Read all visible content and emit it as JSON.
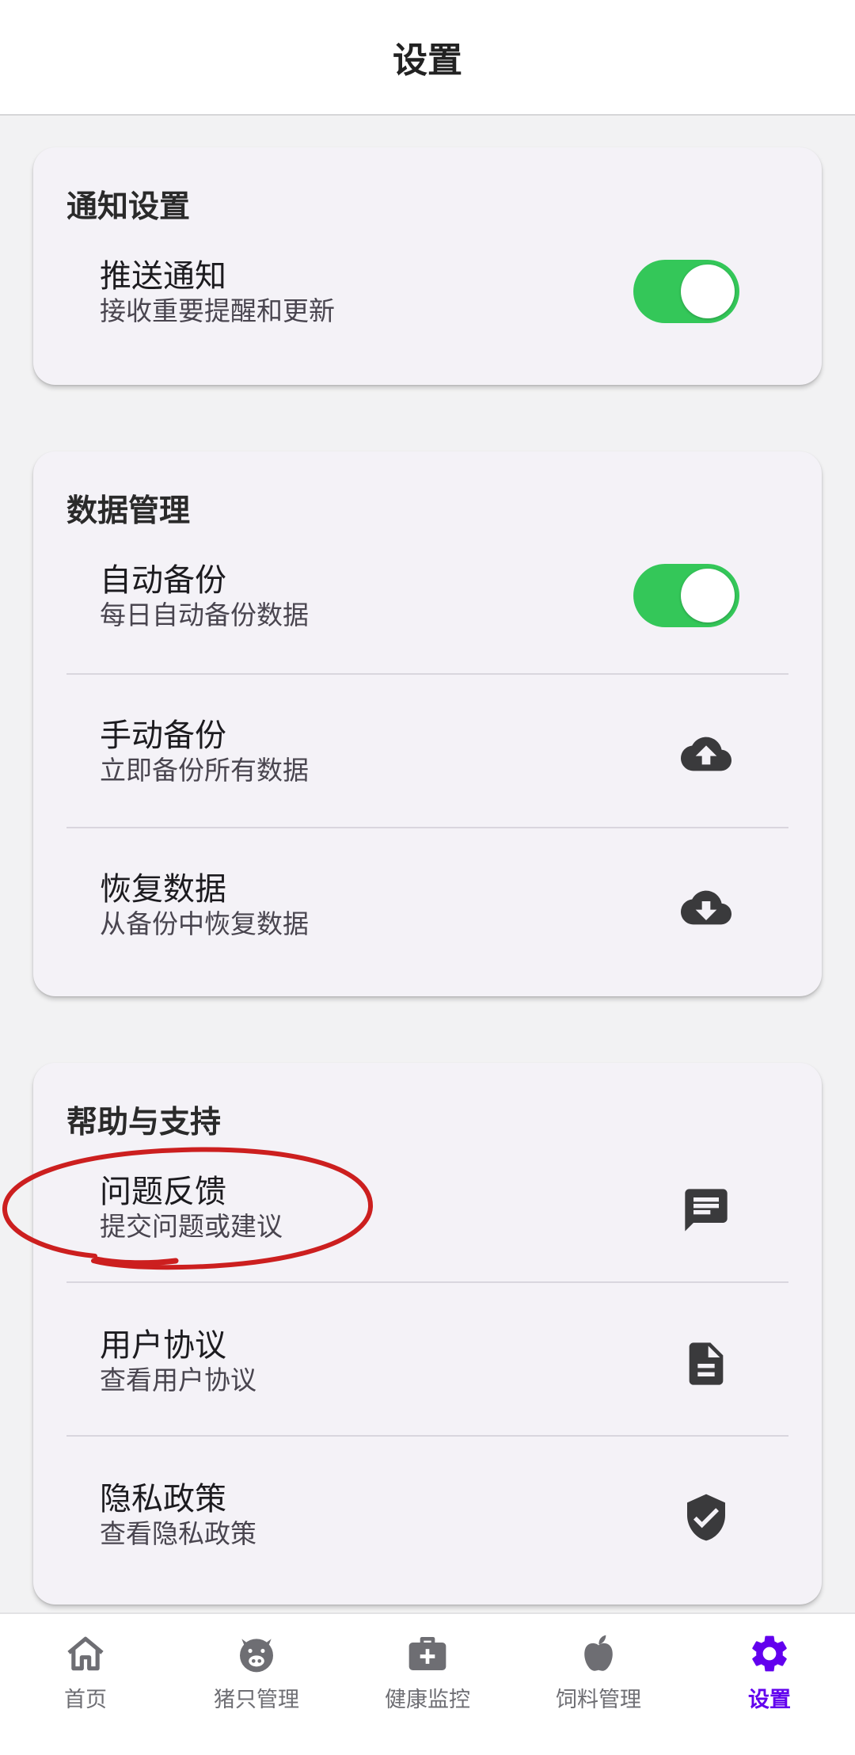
{
  "header": {
    "title": "设置"
  },
  "notification_card": {
    "title": "通知设置",
    "push": {
      "title": "推送通知",
      "subtitle": "接收重要提醒和更新",
      "enabled": true
    }
  },
  "data_card": {
    "title": "数据管理",
    "auto_backup": {
      "title": "自动备份",
      "subtitle": "每日自动备份数据",
      "enabled": true
    },
    "manual_backup": {
      "title": "手动备份",
      "subtitle": "立即备份所有数据",
      "icon": "cloud-upload-icon"
    },
    "restore": {
      "title": "恢复数据",
      "subtitle": "从备份中恢复数据",
      "icon": "cloud-download-icon"
    }
  },
  "help_card": {
    "title": "帮助与支持",
    "feedback": {
      "title": "问题反馈",
      "subtitle": "提交问题或建议",
      "icon": "feedback-icon"
    },
    "agreement": {
      "title": "用户协议",
      "subtitle": "查看用户协议",
      "icon": "document-icon"
    },
    "privacy": {
      "title": "隐私政策",
      "subtitle": "查看隐私政策",
      "icon": "shield-check-icon"
    }
  },
  "tabbar": {
    "items": [
      {
        "label": "首页",
        "icon": "home-icon",
        "active": false
      },
      {
        "label": "猪只管理",
        "icon": "pig-icon",
        "active": false
      },
      {
        "label": "健康监控",
        "icon": "medical-kit-icon",
        "active": false
      },
      {
        "label": "饲料管理",
        "icon": "apple-icon",
        "active": false
      },
      {
        "label": "设置",
        "icon": "gear-icon",
        "active": true
      }
    ]
  },
  "colors": {
    "toggle_on": "#34c759",
    "accent": "#6200ee",
    "annotation_circle": "#cc1f1f",
    "inactive_tab": "#6e6e73"
  }
}
